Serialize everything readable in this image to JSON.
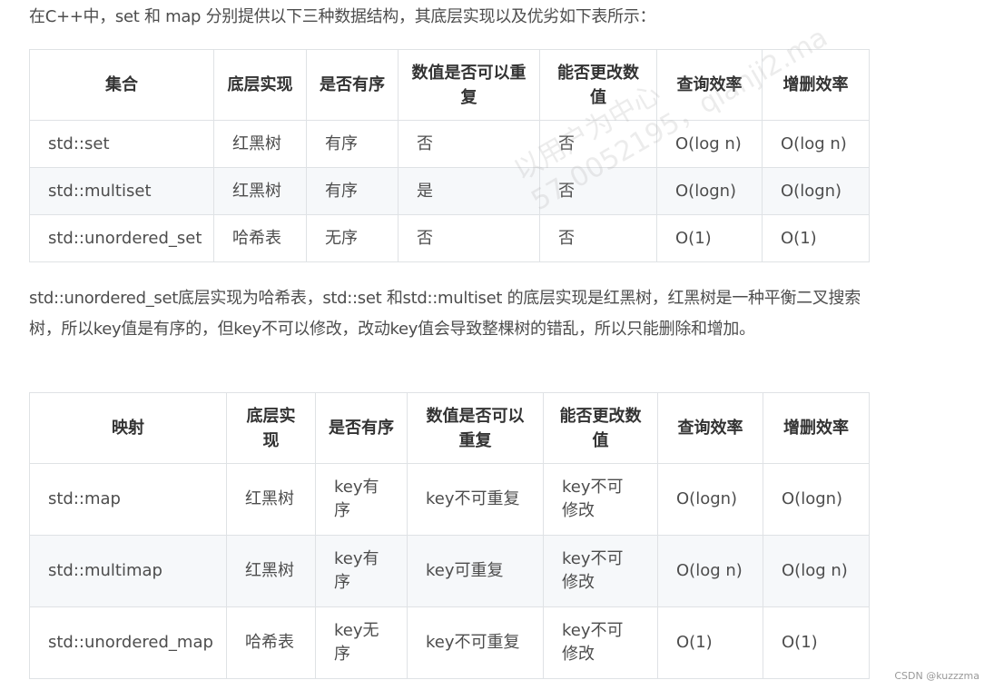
{
  "intro": "在C++中，set 和 map 分别提供以下三种数据结构，其底层实现以及优劣如下表所示：",
  "set_table": {
    "headers": [
      "集合",
      "底层实现",
      "是否有序",
      "数值是否可以重复",
      "能否更改数值",
      "查询效率",
      "增删效率"
    ],
    "rows": [
      [
        "std::set",
        "红黑树",
        "有序",
        "否",
        "否",
        "O(log n)",
        "O(log n)"
      ],
      [
        "std::multiset",
        "红黑树",
        "有序",
        "是",
        "否",
        "O(logn)",
        "O(logn)"
      ],
      [
        "std::unordered_set",
        "哈希表",
        "无序",
        "否",
        "否",
        "O(1)",
        "O(1)"
      ]
    ]
  },
  "middle": "std::unordered_set底层实现为哈希表，std::set 和std::multiset 的底层实现是红黑树，红黑树是一种平衡二叉搜索树，所以key值是有序的，但key不可以修改，改动key值会导致整棵树的错乱，所以只能删除和增加。",
  "map_table": {
    "headers": [
      "映射",
      "底层实现",
      "是否有序",
      "数值是否可以重复",
      "能否更改数值",
      "查询效率",
      "增删效率"
    ],
    "rows": [
      [
        "std::map",
        "红黑树",
        "key有序",
        "key不可重复",
        "key不可修改",
        "O(logn)",
        "O(logn)"
      ],
      [
        "std::multimap",
        "红黑树",
        "key有序",
        "key可重复",
        "key不可修改",
        "O(log n)",
        "O(log n)"
      ],
      [
        "std::unordered_map",
        "哈希表",
        "key无序",
        "key不可重复",
        "key不可修改",
        "O(1)",
        "O(1)"
      ]
    ]
  },
  "watermark": {
    "line1": "以用户为中心",
    "line2": "57-0052195，qianji2.ma"
  },
  "credit": "CSDN @kuzzzma"
}
